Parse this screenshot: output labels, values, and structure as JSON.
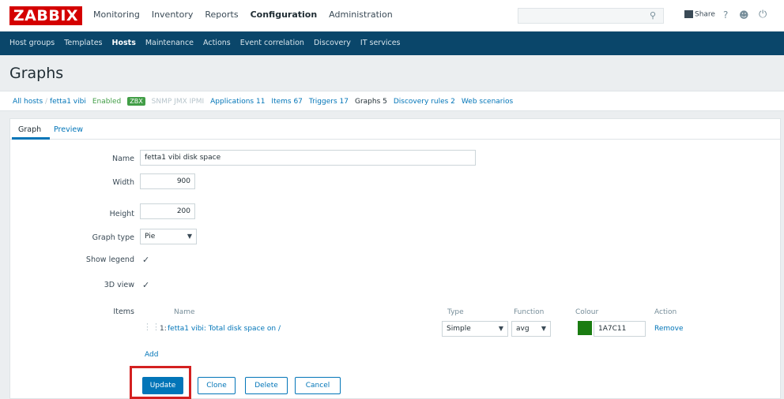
{
  "header": {
    "logo": "ZABBIX",
    "menu": [
      "Monitoring",
      "Inventory",
      "Reports",
      "Configuration",
      "Administration"
    ],
    "active_menu": "Configuration",
    "share_label": "Share",
    "help": "?",
    "user_icon": "user-icon",
    "power_icon": "power-icon"
  },
  "subnav": {
    "items": [
      "Host groups",
      "Templates",
      "Hosts",
      "Maintenance",
      "Actions",
      "Event correlation",
      "Discovery",
      "IT services"
    ],
    "active": "Hosts"
  },
  "page": {
    "title": "Graphs"
  },
  "breadcrumb": {
    "all_hosts": "All hosts",
    "separator": "/",
    "host": "fetta1 vibi",
    "enabled": "Enabled",
    "badge": "ZBX",
    "faded": "SNMP  JMX  IPMI",
    "applications": "Applications 11",
    "items": "Items 67",
    "triggers": "Triggers 17",
    "graphs": "Graphs 5",
    "discovery": "Discovery rules 2",
    "web": "Web scenarios"
  },
  "tabs": {
    "graph": "Graph",
    "preview": "Preview"
  },
  "form": {
    "name_label": "Name",
    "name_value": "fetta1 vibi disk space",
    "width_label": "Width",
    "width_value": "900",
    "height_label": "Height",
    "height_value": "200",
    "graph_type_label": "Graph type",
    "graph_type_value": "Pie",
    "show_legend_label": "Show legend",
    "show_legend_checked": true,
    "view_3d_label": "3D view",
    "view_3d_checked": true,
    "items_label": "Items"
  },
  "items_table": {
    "headers": {
      "name": "Name",
      "type": "Type",
      "function": "Function",
      "colour": "Colour",
      "action": "Action"
    },
    "rows": [
      {
        "index": "1:",
        "name": "fetta1 vibi: Total disk space on /",
        "type": "Simple",
        "function": "avg",
        "colour_hex": "#1A7C11",
        "colour_text": "1A7C11",
        "action": "Remove"
      }
    ],
    "add_label": "Add"
  },
  "buttons": {
    "update": "Update",
    "clone": "Clone",
    "delete": "Delete",
    "cancel": "Cancel"
  },
  "colors": {
    "brand_red": "#d40000",
    "nav_blue": "#0a466a",
    "link_blue": "#0275b8",
    "status_green": "#429e47",
    "highlight_red": "#d42020"
  }
}
